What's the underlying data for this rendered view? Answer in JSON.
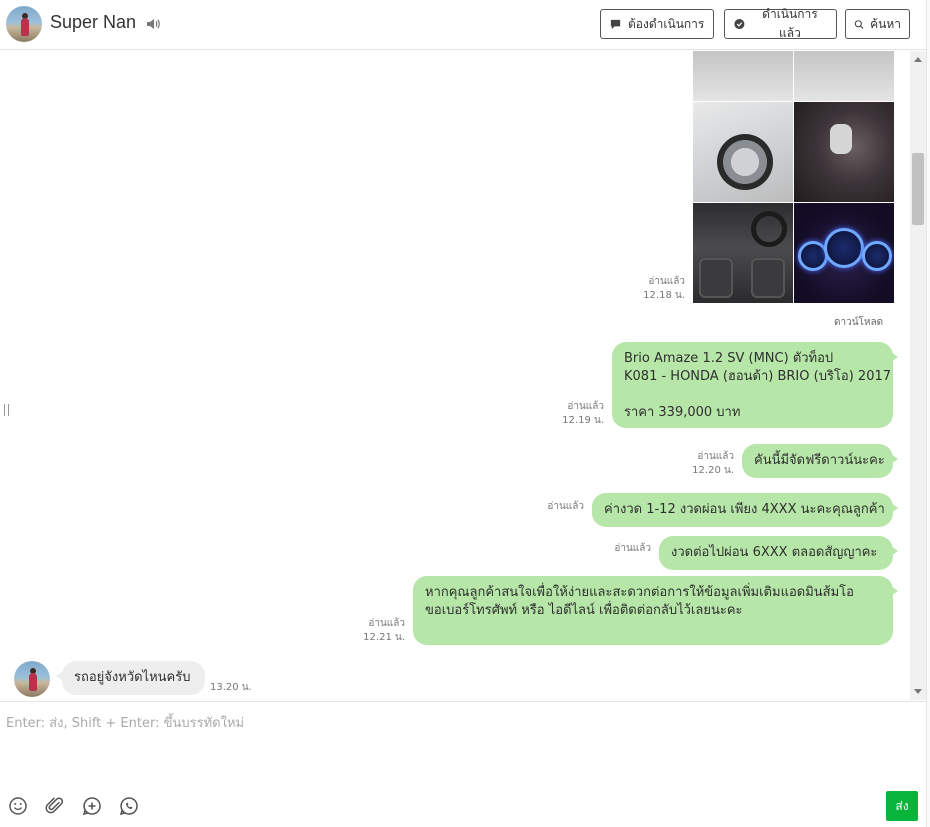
{
  "header": {
    "contact_name": "Super Nan",
    "buttons": {
      "todo": "ต้องดำเนินการ",
      "done": "ดำเนินการแล้ว",
      "search": "ค้นหา"
    }
  },
  "messages": {
    "photos": {
      "read": "อ่านแล้ว",
      "time": "12.18 น.",
      "download": "ดาวน์โหลด"
    },
    "m1": {
      "line1": "Brio Amaze 1.2 SV (MNC) ตัวท็อป",
      "line2": "K081 - HONDA (ฮอนด้า) BRIO (บริโอ) 2017",
      "line3": "ราคา 339,000 บาท",
      "read": "อ่านแล้ว",
      "time": "12.19 น."
    },
    "m2": {
      "text": "คันนี้มีจัดฟรีดาวน์นะคะ",
      "read": "อ่านแล้ว",
      "time": "12.20 น."
    },
    "m3": {
      "text": "ค่างวด 1-12 งวดผ่อน เพียง 4XXX นะคะคุณลูกค้า",
      "read": "อ่านแล้ว"
    },
    "m4": {
      "text": "งวดต่อไปผ่อน 6XXX ตลอดสัญญาคะ",
      "read": "อ่านแล้ว"
    },
    "m5": {
      "line1": "หากคุณลูกค้าสนใจเพื่อให้ง่ายและสะดวกต่อการให้ข้อมูลเพิ่มเติมแอดมินส้มโอ",
      "line2": "ขอเบอร์โทรศัพท์ หรือ ไอดีไลน์ เพื่อติดต่อกลับไว้เลยนะคะ",
      "read": "อ่านแล้ว",
      "time": "12.21 น."
    },
    "incoming": {
      "text": "รถอยู่จังหวัดไหนครับ",
      "time": "13.20 น."
    }
  },
  "composer": {
    "placeholder": "Enter: ส่ง, Shift + Enter: ขึ้นบรรทัดใหม่",
    "send_label": "ส่ง"
  },
  "icons": [
    "speaker-icon",
    "chat-bubble-icon",
    "check-bubble-icon",
    "search-icon",
    "emoji-icon",
    "attachment-icon",
    "add-circle-icon",
    "line-icon"
  ],
  "colors": {
    "bubble_out": "#b7e6a9",
    "bubble_in": "#eeeeee",
    "send": "#07b53b"
  }
}
